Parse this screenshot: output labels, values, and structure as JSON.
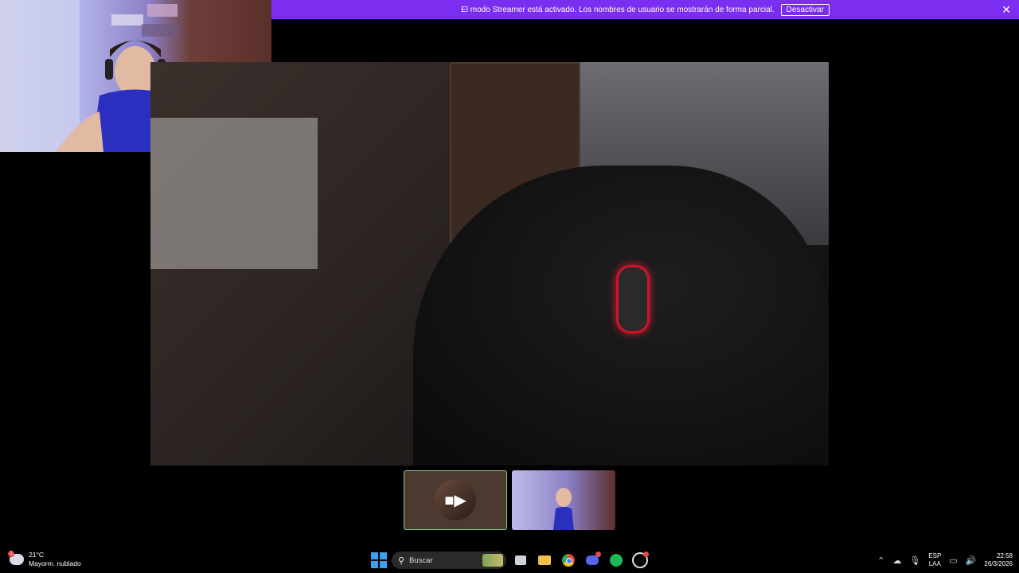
{
  "streamer_bar": {
    "message": "El modo Streamer está activado. Los nombres de usuario se mostrarán de forma parcial.",
    "button": "Desactivar",
    "close": "✕"
  },
  "tiles": {
    "camera_icon": "video-camera-icon"
  },
  "taskbar": {
    "weather": {
      "temp": "21°C",
      "desc": "Mayorm. nublado",
      "badge": "1"
    },
    "search_label": "Buscar",
    "lang_top": "ESP",
    "lang_bottom": "LAA",
    "time": "22:58",
    "date": "26/3/2026"
  }
}
